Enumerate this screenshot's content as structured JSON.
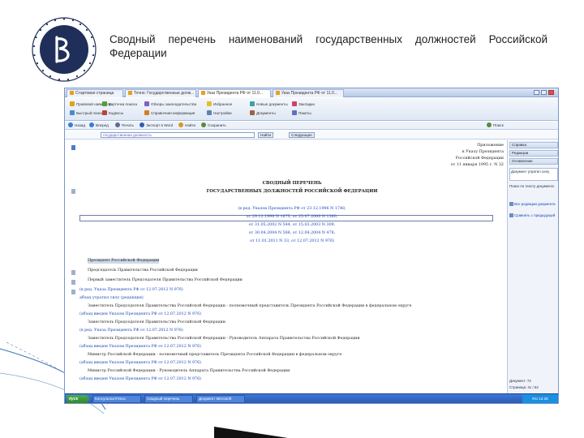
{
  "slide": {
    "title": "Сводный перечень наименований государственных должностей Российской Федерации"
  },
  "browser": {
    "tabs": [
      {
        "label": "Стартовая страница"
      },
      {
        "label": "Точно: Государственные долж..."
      },
      {
        "label": "Указ Президента РФ от 11.0..."
      },
      {
        "label": "Указ Президента РФ от 11.0..."
      }
    ],
    "ribbon": [
      {
        "label": "Правовой навигатор",
        "color": "#e0a020"
      },
      {
        "label": "Быстрый поиск",
        "color": "#4a8ad0"
      },
      {
        "label": "Карточка поиска",
        "color": "#5a9a40"
      },
      {
        "label": "Кодексы",
        "color": "#c04040"
      },
      {
        "label": "Обзоры законодательства",
        "color": "#8060c0"
      },
      {
        "label": "Справочная информация",
        "color": "#d08020"
      },
      {
        "label": "Избранное",
        "color": "#e0c030"
      },
      {
        "label": "Настройки",
        "color": "#6080b0"
      },
      {
        "label": "Новые документы",
        "color": "#40a0a0"
      },
      {
        "label": "Документы",
        "color": "#a06040"
      },
      {
        "label": "Закладки",
        "color": "#d04070"
      },
      {
        "label": "Пакеты",
        "color": "#6070c0"
      }
    ],
    "nav": [
      {
        "label": "Назад",
        "color": "#3a7bd5"
      },
      {
        "label": "Вперед",
        "color": "#3a7bd5"
      },
      {
        "label": "Печать",
        "color": "#5a6e90"
      },
      {
        "label": "Экспорт в Word",
        "color": "#2b5fb5"
      },
      {
        "label": "Найти",
        "color": "#d49a20"
      },
      {
        "label": "Сохранить",
        "color": "#5a8a3a"
      }
    ],
    "nav_right": "Поиск",
    "address_value": "государственная должность",
    "find_button": "Найти",
    "next_button": "Следующее"
  },
  "document": {
    "approval": [
      "Приложение",
      "к Указу Президента",
      "Российской Федерации",
      "от 11 января 1995 г. N 32"
    ],
    "heading1": "СВОДНЫЙ ПЕРЕЧЕНЬ",
    "heading2": "ГОСУДАРСТВЕННЫХ ДОЛЖНОСТЕЙ РОССИЙСКОЙ ФЕДЕРАЦИИ",
    "revisions": [
      "(в ред. Указов Президента РФ от 23.12.1996 N 1748,",
      "от 29.12.1998 N 1675, от 25.07.2000 N 1360,",
      "от 31.05.2002 N 544, от 15.03.2003 N 309,",
      "от 30.04.2004 N 586, от 12.04.2004 N 478,",
      "от 11.01.2011 N 33, от 12.07.2012 N 976)"
    ],
    "items": [
      "Президент Российской Федерации",
      "Председатель Правительства Российской Федерации",
      "Первый заместитель Председателя Правительства Российской Федерации",
      "(в ред. Указа Президента РФ от 12.07.2012 N 976)",
      "абзац утратил силу (редакция)",
      "Заместитель Председателя Правительства Российской Федерации - полномочный представитель Президента Российской Федерации в федеральном округе",
      "(абзац введен Указом Президента РФ от 12.07.2012 N 976)",
      "Заместитель Председателя Правительства Российской Федерации",
      "(в ред. Указа Президента РФ от 12.07.2012 N 976)",
      "Заместитель Председателя Правительства Российской Федерации - Руководитель Аппарата Правительства Российской Федерации",
      "(абзац введен Указом Президента РФ от 12.07.2012 N 976)",
      "Министр Российской Федерации - полномочный представитель Президента Российской Федерации в федеральном округе",
      "(абзац введен Указом Президента РФ от 12.07.2012 N 976)",
      "Министр Российской Федерации - Руководитель Аппарата Правительства Российской Федерации",
      "(абзац введен Указом Президента РФ от 12.07.2012 N 976)"
    ]
  },
  "sidebar": {
    "headers": [
      "Справка",
      "Редакции",
      "Оглавление"
    ],
    "info": "Документ утратил силу",
    "info2": "Поиск по тексту документа",
    "links": [
      "Все редакции документа",
      "Сравнить с предыдущей"
    ],
    "status1": "Документ: 72",
    "status2": "Страница: 41 / 62"
  },
  "taskbar": {
    "start": "пуск",
    "tasks": [
      "КонсультантПлюс",
      "Сводный перечень",
      "Документ Microsoft"
    ],
    "clock": "RU 12:28"
  }
}
